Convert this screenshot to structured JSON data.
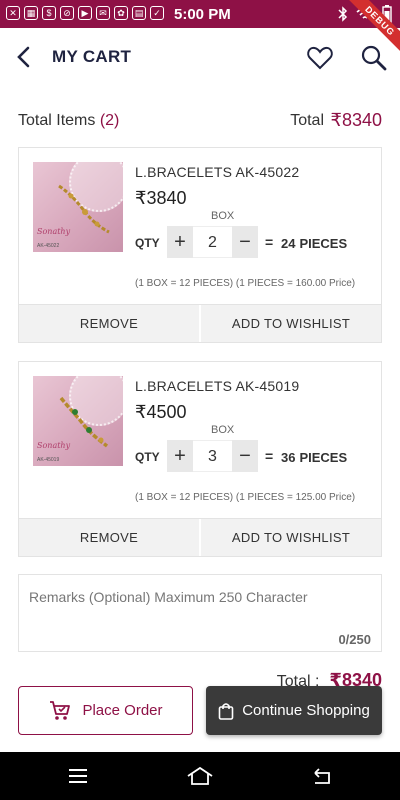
{
  "status_bar": {
    "time": "5:00 PM",
    "debug_label": "DEBUG"
  },
  "header": {
    "title": "MY CART"
  },
  "summary": {
    "total_items_label": "Total Items",
    "total_items_count": "(2)",
    "total_label": "Total",
    "total_value": "₹8340"
  },
  "cart": {
    "items": [
      {
        "name": "L.BRACELETS AK-45022",
        "price": "₹3840",
        "box_label": "BOX",
        "qty_label": "QTY",
        "plus": "+",
        "minus": "−",
        "quantity": "2",
        "equals": "=",
        "pieces_count": "24",
        "pieces_unit": "PIECES",
        "conversion": "(1 BOX = 12 PIECES)  (1 PIECES = 160.00 Price)",
        "thumb_brand": "Sonathy",
        "remove_label": "REMOVE",
        "wishlist_label": "ADD TO WISHLIST"
      },
      {
        "name": "L.BRACELETS AK-45019",
        "price": "₹4500",
        "box_label": "BOX",
        "qty_label": "QTY",
        "plus": "+",
        "minus": "−",
        "quantity": "3",
        "equals": "=",
        "pieces_count": "36",
        "pieces_unit": "PIECES",
        "conversion": "(1 BOX = 12 PIECES)  (1 PIECES = 125.00 Price)",
        "thumb_brand": "Sonathy",
        "remove_label": "REMOVE",
        "wishlist_label": "ADD TO WISHLIST"
      }
    ]
  },
  "remarks": {
    "placeholder": "Remarks (Optional) Maximum 250 Character",
    "counter": "0/250"
  },
  "footer_total": {
    "label": "Total :",
    "value": "₹8340"
  },
  "actions": {
    "place_order_label": "Place Order",
    "continue_label": "Continue Shopping"
  },
  "colors": {
    "accent": "#8e1146",
    "dark_button": "#3a3a3a"
  },
  "icons": [
    "back-arrow-icon",
    "heart-icon",
    "search-icon",
    "cart-icon",
    "shopping-bag-icon",
    "menu-icon",
    "home-icon",
    "back-icon"
  ]
}
